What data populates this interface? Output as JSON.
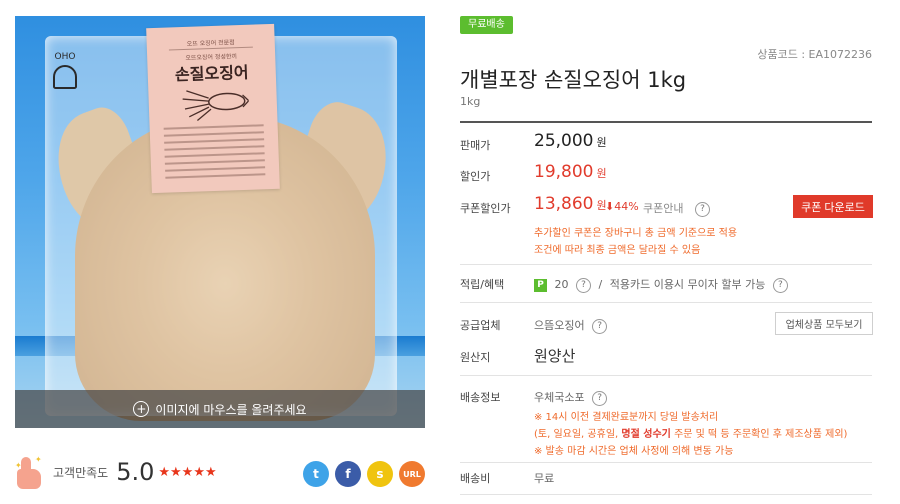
{
  "image": {
    "caption": "이미지에 마우스를 올려주세요",
    "package_label": {
      "brand_line": "오뜨 오징어 전문점",
      "sub_line": "오뜨오징어 정성한끼",
      "title": "손질오징어"
    },
    "logo_text": "OHO"
  },
  "satisfaction": {
    "label": "고객만족도",
    "score": "5.0",
    "stars": "★★★★★",
    "rating": 5
  },
  "share": {
    "twitter": "t",
    "facebook": "f",
    "kakaostory": "s",
    "url": "URL"
  },
  "product": {
    "badge": "무료배송",
    "code": "상품코드 : EA1072236",
    "title": "개별포장 손질오징어 1kg",
    "subtitle": "1kg"
  },
  "price": {
    "sale_label": "판매가",
    "sale_value": "25,000",
    "discount_label": "할인가",
    "discount_value": "19,800",
    "coupon_label": "쿠폰할인가",
    "coupon_value": "13,860",
    "currency": "원",
    "drop": "⬇44%",
    "coupon_guide": "쿠폰안내",
    "coupon_button": "쿠폰 다운로드",
    "note1": "추가할인 쿠폰은 장바구니 총 금액 기준으로 적용",
    "note2": "조건에 따라 최종 금액은 달라질 수 있음"
  },
  "benefit": {
    "label": "적립/혜택",
    "points_icon": "P",
    "points": "20",
    "separator": "/",
    "card_text": "적용카드 이용시 무이자 할부 가능"
  },
  "supplier": {
    "label": "공급업체",
    "name": "으뜸오징어",
    "button": "업체상품 모두보기"
  },
  "origin": {
    "label": "원산지",
    "value": "원양산"
  },
  "shipping": {
    "label": "배송정보",
    "method": "우체국소포",
    "note1": "※ 14시 이전 결제완료분까지 당일 발송처리",
    "note2_a": "(토, 일요일, 공휴일,",
    "note2_b": "명절 성수기",
    "note2_c": "주문 및 떡 등 주문확인 후 제조상품 제외)",
    "note3": "※ 발송 마감 시간은 업체 사정에 의해 변동 가능"
  },
  "shipping_fee": {
    "label": "배송비",
    "value": "무료"
  },
  "help_icon": "?"
}
